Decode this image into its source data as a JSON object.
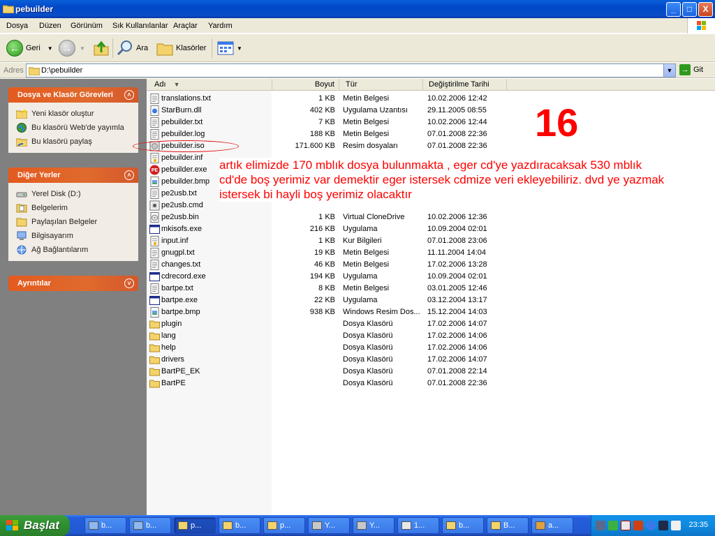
{
  "window": {
    "title": "pebuilder",
    "buttons": [
      "_",
      "□",
      "X"
    ]
  },
  "menu": [
    "Dosya",
    "Düzen",
    "Görünüm",
    "Sık Kullanılanlar",
    "Araçlar",
    "Yardım"
  ],
  "toolbar": {
    "back_label": "Geri",
    "search_label": "Ara",
    "folders_label": "Klasörler"
  },
  "address": {
    "label": "Adres",
    "value": "D:\\pebuilder",
    "go_label": "Git"
  },
  "tasks_panel": {
    "title": "Dosya ve Klasör Görevleri",
    "items": [
      "Yeni klasör oluştur",
      "Bu klasörü Web'de yayımla",
      "Bu klasörü paylaş"
    ]
  },
  "places_panel": {
    "title": "Diğer Yerler",
    "items": [
      "Yerel Disk (D:)",
      "Belgelerim",
      "Paylaşılan Belgeler",
      "Bilgisayarım",
      "Ağ Bağlantılarım"
    ]
  },
  "details_panel": {
    "title": "Ayrıntılar"
  },
  "columns": {
    "name": "Adı",
    "size": "Boyut",
    "type": "Tür",
    "date": "Değiştirilme Tarihi"
  },
  "files": [
    {
      "name": "translations.txt",
      "size": "1 KB",
      "type": "Metin Belgesi",
      "date": "10.02.2006 12:42",
      "icon": "text-file-icon"
    },
    {
      "name": "StarBurn.dll",
      "size": "402 KB",
      "type": "Uygulama Uzantısı",
      "date": "29.11.2005 08:55",
      "icon": "dll-file-icon"
    },
    {
      "name": "pebuilder.txt",
      "size": "7 KB",
      "type": "Metin Belgesi",
      "date": "10.02.2006 12:44",
      "icon": "text-file-icon"
    },
    {
      "name": "pebuilder.log",
      "size": "188 KB",
      "type": "Metin Belgesi",
      "date": "07.01.2008 22:36",
      "icon": "text-file-icon"
    },
    {
      "name": "pebuilder.iso",
      "size": "171.600 KB",
      "type": "Resim dosyaları",
      "date": "07.01.2008 22:36",
      "icon": "iso-file-icon"
    },
    {
      "name": "pebuilder.inf",
      "size": "",
      "type": "",
      "date": "",
      "icon": "inf-file-icon"
    },
    {
      "name": "pebuilder.exe",
      "size": "",
      "type": "",
      "date": "",
      "icon": "pe-exe-icon"
    },
    {
      "name": "pebuilder.bmp",
      "size": "",
      "type": "",
      "date": "",
      "icon": "bitmap-file-icon"
    },
    {
      "name": "pe2usb.txt",
      "size": "",
      "type": "",
      "date": "",
      "icon": "text-file-icon"
    },
    {
      "name": "pe2usb.cmd",
      "size": "",
      "type": "",
      "date": "",
      "icon": "cmd-file-icon"
    },
    {
      "name": "pe2usb.bin",
      "size": "1 KB",
      "type": "Virtual CloneDrive",
      "date": "10.02.2006 12:36",
      "icon": "bin-file-icon"
    },
    {
      "name": "mkisofs.exe",
      "size": "216 KB",
      "type": "Uygulama",
      "date": "10.09.2004 02:01",
      "icon": "exe-file-icon"
    },
    {
      "name": "input.inf",
      "size": "1 KB",
      "type": "Kur Bilgileri",
      "date": "07.01.2008 23:06",
      "icon": "inf-file-icon"
    },
    {
      "name": "gnugpl.txt",
      "size": "19 KB",
      "type": "Metin Belgesi",
      "date": "11.11.2004 14:04",
      "icon": "text-file-icon"
    },
    {
      "name": "changes.txt",
      "size": "46 KB",
      "type": "Metin Belgesi",
      "date": "17.02.2006 13:28",
      "icon": "text-file-icon"
    },
    {
      "name": "cdrecord.exe",
      "size": "194 KB",
      "type": "Uygulama",
      "date": "10.09.2004 02:01",
      "icon": "exe-file-icon"
    },
    {
      "name": "bartpe.txt",
      "size": "8 KB",
      "type": "Metin Belgesi",
      "date": "03.01.2005 12:46",
      "icon": "text-file-icon"
    },
    {
      "name": "bartpe.exe",
      "size": "22 KB",
      "type": "Uygulama",
      "date": "03.12.2004 13:17",
      "icon": "exe-file-icon"
    },
    {
      "name": "bartpe.bmp",
      "size": "938 KB",
      "type": "Windows Resim Dos...",
      "date": "15.12.2004 14:03",
      "icon": "bitmap-file-icon"
    },
    {
      "name": "plugin",
      "size": "",
      "type": "Dosya Klasörü",
      "date": "17.02.2006 14:07",
      "icon": "folder-icon"
    },
    {
      "name": "lang",
      "size": "",
      "type": "Dosya Klasörü",
      "date": "17.02.2006 14:06",
      "icon": "folder-icon"
    },
    {
      "name": "help",
      "size": "",
      "type": "Dosya Klasörü",
      "date": "17.02.2006 14:06",
      "icon": "folder-icon"
    },
    {
      "name": "drivers",
      "size": "",
      "type": "Dosya Klasörü",
      "date": "17.02.2006 14:07",
      "icon": "folder-icon"
    },
    {
      "name": "BartPE_EK",
      "size": "",
      "type": "Dosya Klasörü",
      "date": "07.01.2008 22:14",
      "icon": "folder-icon"
    },
    {
      "name": "BartPE",
      "size": "",
      "type": "Dosya Klasörü",
      "date": "07.01.2008 22:36",
      "icon": "folder-icon"
    }
  ],
  "annotation": {
    "number": "16",
    "text": "artık elimizde 170 mblık dosya bulunmakta , eger cd'ye yazdıracaksak 530 mblık cd'de boş yerimiz var demektir eger istersek cdmize veri ekleyebiliriz. dvd ye yazmak istersek bi hayli boş yerimiz olacaktır",
    "color": "#ff0000"
  },
  "taskbar": {
    "start_label": "Başlat",
    "tasks": [
      {
        "label": "b...",
        "icon": "document-icon",
        "active": false
      },
      {
        "label": "b...",
        "icon": "document-icon",
        "active": false
      },
      {
        "label": "p...",
        "icon": "folder-icon",
        "active": true
      },
      {
        "label": "b...",
        "icon": "folder-icon",
        "active": false
      },
      {
        "label": "p...",
        "icon": "folder-icon",
        "active": false
      },
      {
        "label": "Y...",
        "icon": "disk-icon",
        "active": false
      },
      {
        "label": "Y...",
        "icon": "disk-icon",
        "active": false
      },
      {
        "label": "1...",
        "icon": "image-icon",
        "active": false
      },
      {
        "label": "b...",
        "icon": "folder-icon",
        "active": false
      },
      {
        "label": "B...",
        "icon": "folder-icon",
        "active": false
      },
      {
        "label": "a...",
        "icon": "paint-icon",
        "active": false
      }
    ],
    "clock": "23:35"
  },
  "colors": {
    "title_blue": "#0a4dc7",
    "panel_orange": "#e35a1e",
    "left_pane_grey": "#808080"
  }
}
